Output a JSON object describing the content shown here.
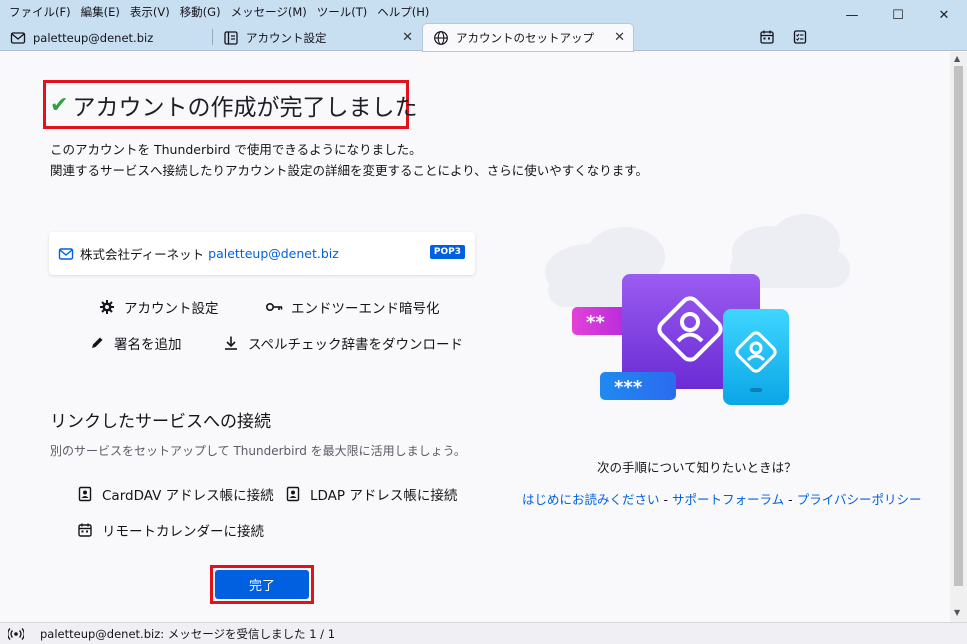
{
  "menubar": {
    "items": [
      "ファイル(F)",
      "編集(E)",
      "表示(V)",
      "移動(G)",
      "メッセージ(M)",
      "ツール(T)",
      "ヘルプ(H)"
    ]
  },
  "window_controls": {
    "minimize": "—",
    "maximize": "☐",
    "close": "✕"
  },
  "tabs": [
    {
      "label": "paletteup@denet.biz",
      "icon": "mail-icon"
    },
    {
      "label": "アカウント設定",
      "icon": "settings-page-icon"
    },
    {
      "label": "アカウントのセットアップ",
      "icon": "globe-icon"
    }
  ],
  "tab_close": "✕",
  "page": {
    "heading": "アカウントの作成が完了しました",
    "intro_line1": "このアカウントを Thunderbird で使用できるようになりました。",
    "intro_line2": "関連するサービスへ接続したりアカウント設定の詳細を変更することにより、さらに使いやすくなります。",
    "account": {
      "name": "株式会社ディーネット",
      "email": "paletteup@denet.biz",
      "type": "POP3"
    },
    "actions": {
      "account_settings": "アカウント設定",
      "e2e": "エンドツーエンド暗号化",
      "signature": "署名を追加",
      "spellcheck": "スペルチェック辞書をダウンロード"
    },
    "services": {
      "title": "リンクしたサービスへの接続",
      "description": "別のサービスをセットアップして Thunderbird を最大限に活用しましょう。",
      "carddav": "CardDAV アドレス帳に接続",
      "ldap": "LDAP アドレス帳に接続",
      "calendar": "リモートカレンダーに接続"
    },
    "done_button": "完了",
    "help": {
      "question": "次の手順について知りたいときは？",
      "link1": "はじめにお読みください",
      "link2": "サポートフォーラム",
      "link3": "プライバシーポリシー",
      "separator": "-"
    }
  },
  "statusbar": {
    "text": "paletteup@denet.biz: メッセージを受信しました 1 / 1"
  },
  "colors": {
    "accent": "#0060df",
    "highlight": "#e3111c",
    "success": "#2ea140",
    "tabbar": "#c8dff2"
  }
}
